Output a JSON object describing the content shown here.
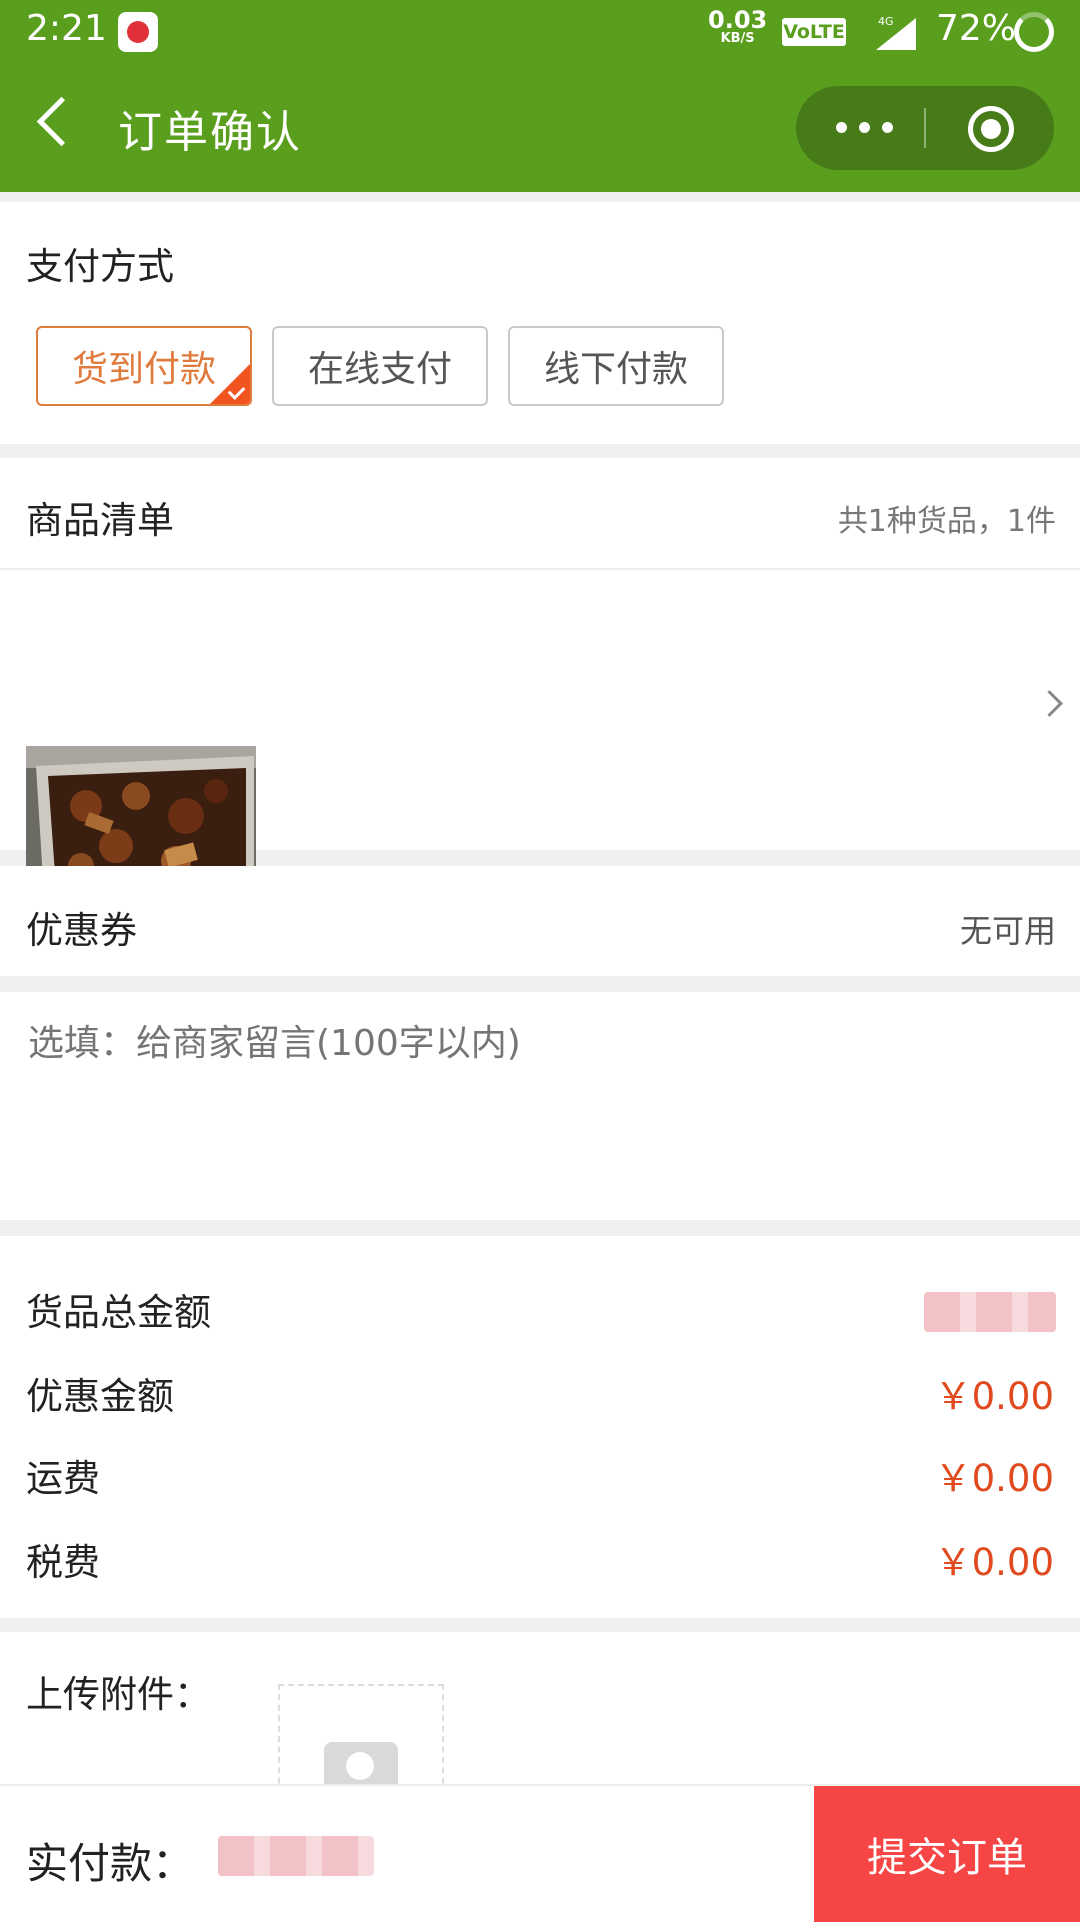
{
  "status": {
    "time": "2:21",
    "speed_value": "0.03",
    "speed_unit": "KB/S",
    "volte": "VoLTE",
    "network": "4G",
    "battery": "72%"
  },
  "nav": {
    "title": "订单确认"
  },
  "payment": {
    "heading": "支付方式",
    "options": [
      {
        "label": "货到付款",
        "selected": true
      },
      {
        "label": "在线支付",
        "selected": false
      },
      {
        "label": "线下付款",
        "selected": false
      }
    ]
  },
  "goods": {
    "heading": "商品清单",
    "summary": "共1种货品，1件"
  },
  "coupon": {
    "label": "优惠券",
    "value": "无可用"
  },
  "message": {
    "placeholder": "选填：给商家留言(100字以内)"
  },
  "amounts": [
    {
      "label": "货品总金额",
      "value": ""
    },
    {
      "label": "优惠金额",
      "value": "￥0.00"
    },
    {
      "label": "运费",
      "value": "￥0.00"
    },
    {
      "label": "税费",
      "value": "￥0.00"
    }
  ],
  "attachment": {
    "label": "上传附件："
  },
  "footer": {
    "pay_label": "实付款：",
    "submit": "提交订单"
  },
  "colors": {
    "brand_green": "#5a9e1e",
    "accent_orange": "#e07b3e",
    "price_red": "#e04a1e",
    "submit_red": "#f64545"
  }
}
